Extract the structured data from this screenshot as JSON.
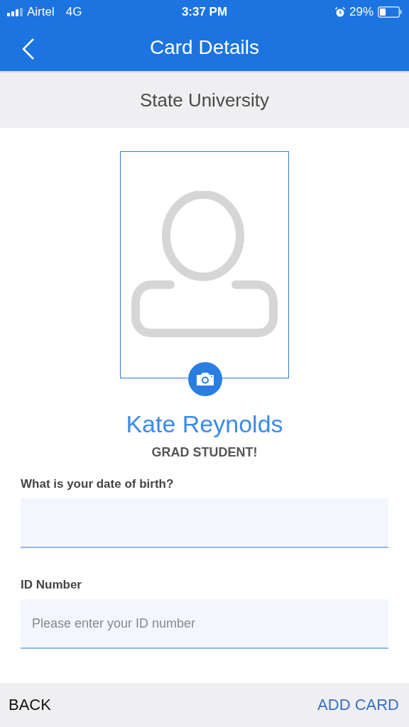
{
  "status_bar": {
    "carrier": "Airtel",
    "network": "4G",
    "time": "3:37 PM",
    "battery": "29%"
  },
  "nav": {
    "title": "Card Details"
  },
  "header": {
    "title": "State University"
  },
  "profile": {
    "name": "Kate Reynolds",
    "role": "GRAD STUDENT!"
  },
  "fields": [
    {
      "label": "What is your date of birth?"
    },
    {
      "label": "ID Number",
      "placeholder": "Please enter your ID number"
    }
  ],
  "footer": {
    "back": "BACK",
    "add": "ADD CARD"
  }
}
